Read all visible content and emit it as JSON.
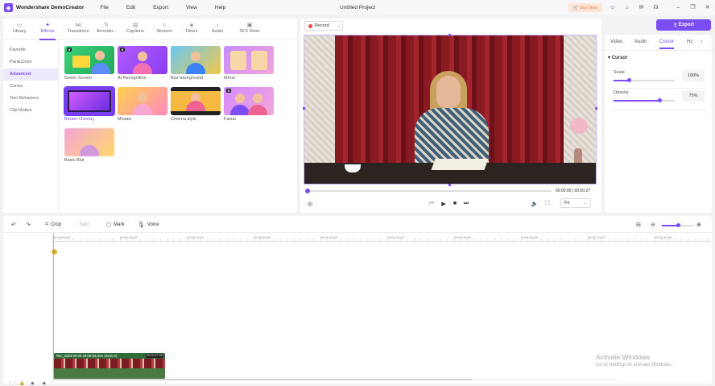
{
  "titlebar": {
    "app_name": "Wondershare DemoCreator",
    "menu": [
      "File",
      "Edit",
      "Export",
      "View",
      "Help"
    ],
    "project_title": "Untitled Project",
    "buy_now": "Buy Now"
  },
  "left_panel": {
    "tabs": [
      {
        "label": "Library",
        "icon": "library-icon"
      },
      {
        "label": "Effects",
        "icon": "effects-icon",
        "active": true
      },
      {
        "label": "Transitions",
        "icon": "transitions-icon"
      },
      {
        "label": "Annotati...",
        "icon": "annotation-icon"
      },
      {
        "label": "Captions",
        "icon": "captions-icon"
      },
      {
        "label": "Stickers",
        "icon": "stickers-icon"
      },
      {
        "label": "Filters",
        "icon": "filters-icon"
      },
      {
        "label": "Audio",
        "icon": "audio-icon"
      },
      {
        "label": "SFX Store",
        "icon": "sfx-store-icon"
      }
    ],
    "categories": [
      "Favorite",
      "Pan&Zoom",
      "Advanced",
      "Cursor",
      "Text Behaviors",
      "Clip Motion"
    ],
    "active_category": "Advanced",
    "effects": [
      {
        "label": "Green Screen",
        "premium": true
      },
      {
        "label": "AI Recognition",
        "premium": true
      },
      {
        "label": "Blur background",
        "premium": false
      },
      {
        "label": "Mirror",
        "premium": false
      },
      {
        "label": "Border Overlay",
        "premium": false,
        "selected": true
      },
      {
        "label": "Mosaic",
        "premium": false
      },
      {
        "label": "Cinema style",
        "premium": false
      },
      {
        "label": "Facial",
        "premium": true
      },
      {
        "label": "Basic Blur",
        "premium": false
      }
    ]
  },
  "preview": {
    "record_label": "Record",
    "current_time": "00:00:00",
    "total_time": "00:00:27",
    "fit_label": "Fit",
    "progress": 0.0
  },
  "export_label": "Export",
  "properties": {
    "tabs": [
      "Video",
      "Audio",
      "Cursor",
      "Hc"
    ],
    "active_tab": "Cursor",
    "section": "Cursor",
    "scale_label": "Scale",
    "scale_value": "100%",
    "scale_fraction": 0.25,
    "opacity_label": "Opacity",
    "opacity_value": "75%",
    "opacity_fraction": 0.75
  },
  "timeline": {
    "tools": [
      "Crop",
      "Split",
      "Mark",
      "Voice"
    ],
    "ticks": [
      "00:00:00:00",
      "00:00:16:20",
      "00:00:33:10",
      "00:00:50:00",
      "00:01:06:20",
      "00:01:23:10",
      "00:01:40:00",
      "00:01:56:20",
      "00:02:13:10",
      "00:02:30:00"
    ],
    "playhead_marker": "E",
    "clip_name": "Rec_2023-05-30 16-06-53.dcrc (Screen)",
    "clip_duration": "00:00:27:05"
  },
  "activate_windows": {
    "title": "Activate Windows",
    "subtitle": "Go to Settings to activate Windows."
  },
  "colors": {
    "accent": "#7b4df3",
    "playhead": "#e8b93c",
    "record": "#f04a4a"
  }
}
